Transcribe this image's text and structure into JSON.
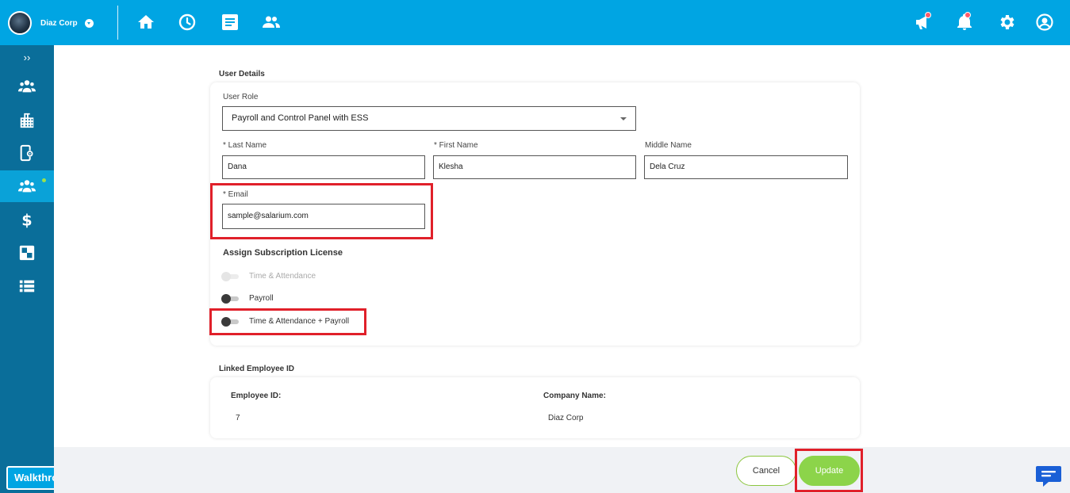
{
  "topbar": {
    "company_name": "Diaz Corp",
    "nav_icons": [
      "home-icon",
      "clock-icon",
      "document-icon",
      "people-icon"
    ],
    "right_icons": [
      "megaphone-icon",
      "bell-icon",
      "gear-icon",
      "user-icon"
    ]
  },
  "sidebar": {
    "expand_label": "››",
    "items": [
      "people-icon",
      "building-icon",
      "device-settings-icon",
      "people-icon",
      "dollar-icon",
      "modules-icon",
      "list-icon"
    ],
    "active_index": 3,
    "walkthroughs_label": "Walkthroughs"
  },
  "user_details": {
    "section_title": "User Details",
    "user_role_label": "User Role",
    "user_role_value": "Payroll and Control Panel with ESS",
    "last_name_label": "* Last Name",
    "last_name_value": "Dana",
    "first_name_label": "* First Name",
    "first_name_value": "Klesha",
    "middle_name_label": "Middle Name",
    "middle_name_value": "Dela Cruz",
    "email_label": "* Email",
    "email_value": "sample@salarium.com"
  },
  "subscription": {
    "title": "Assign Subscription License",
    "options": [
      {
        "label": "Time & Attendance",
        "enabled": false
      },
      {
        "label": "Payroll",
        "enabled": true
      },
      {
        "label": "Time & Attendance + Payroll",
        "enabled": true
      }
    ]
  },
  "linked_employee": {
    "section_title": "Linked Employee ID",
    "employee_id_label": "Employee ID:",
    "employee_id_value": "7",
    "company_name_label": "Company Name:",
    "company_name_value": "Diaz Corp"
  },
  "actions": {
    "cancel_label": "Cancel",
    "update_label": "Update"
  },
  "colors": {
    "topbar": "#00a5e3",
    "sidebar": "#0a6e9a",
    "highlight": "#e0202a",
    "update_button": "#8cd44a"
  }
}
